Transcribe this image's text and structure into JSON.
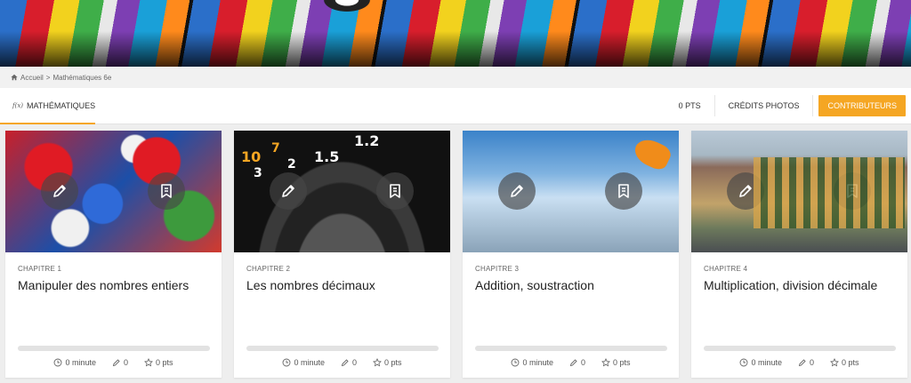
{
  "breadcrumb": {
    "home": "Accueil",
    "separator": ">",
    "current": "Mathématiques 6e"
  },
  "nav": {
    "subject_symbol": "f(x)",
    "subject_label": "MATHÉMATIQUES",
    "points": "0 PTS",
    "photo_credits": "CRÉDITS PHOTOS",
    "contributors": "CONTRIBUTEURS"
  },
  "colors": {
    "accent": "#f5a623",
    "background": "#eeeeee"
  },
  "cards": [
    {
      "chapter": "CHAPITRE 1",
      "title": "Manipuler des nombres entiers",
      "progress": 0,
      "duration": "0 minute",
      "exercises": "0",
      "points": "0 pts",
      "image": "dice"
    },
    {
      "chapter": "CHAPITRE 2",
      "title": "Les nombres décimaux",
      "progress": 0,
      "duration": "0 minute",
      "exercises": "0",
      "points": "0 pts",
      "image": "camera-lens"
    },
    {
      "chapter": "CHAPITRE 3",
      "title": "Addition, soustraction",
      "progress": 0,
      "duration": "0 minute",
      "exercises": "0",
      "points": "0 pts",
      "image": "goldfish-splash"
    },
    {
      "chapter": "CHAPITRE 4",
      "title": "Multiplication, division décimale",
      "progress": 0,
      "duration": "0 minute",
      "exercises": "0",
      "points": "0 pts",
      "image": "giraffe-street"
    }
  ],
  "icons": {
    "edit": "pencil-icon",
    "lesson": "bookmark-icon",
    "time": "clock-icon",
    "exercises": "pencil-icon",
    "points": "star-icon",
    "home": "home-icon"
  }
}
